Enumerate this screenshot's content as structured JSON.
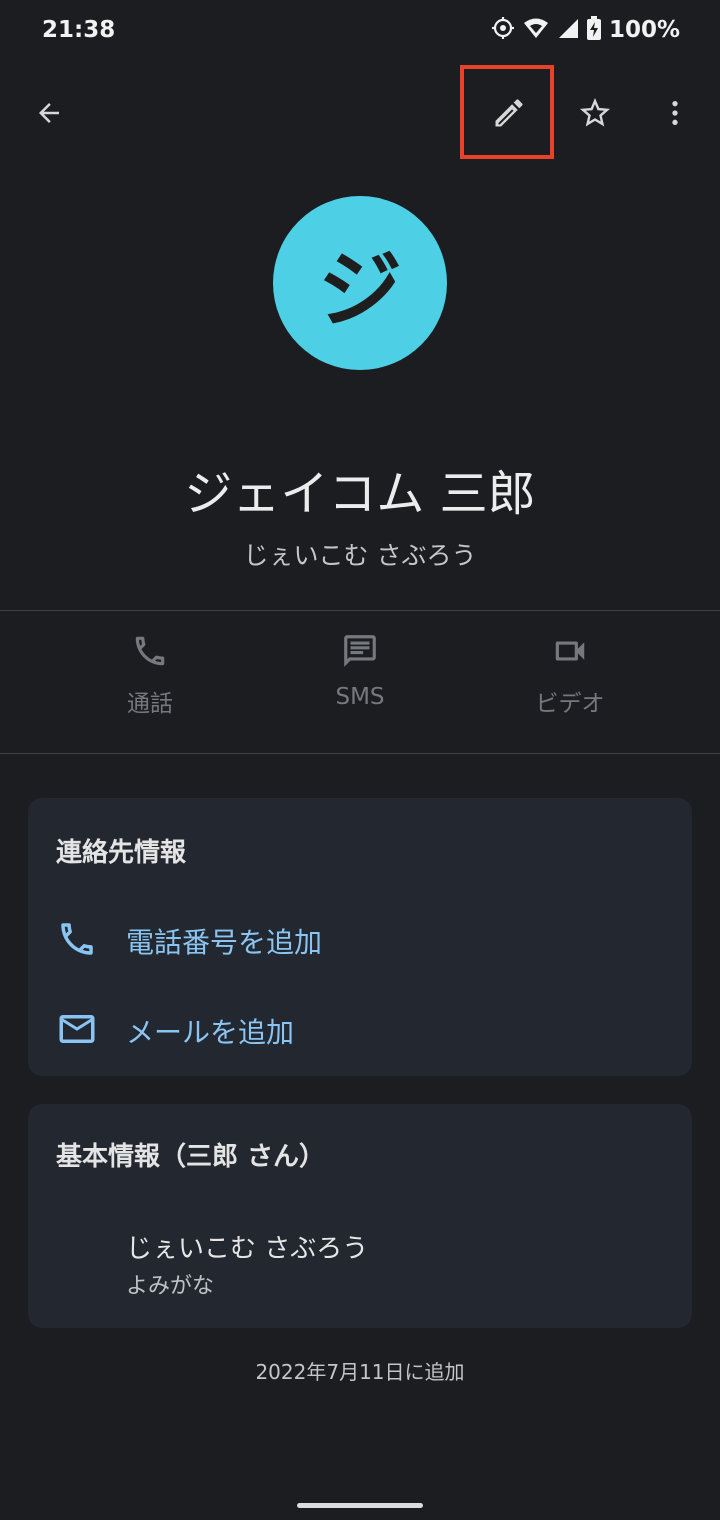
{
  "status_bar": {
    "time": "21:38",
    "battery": "100%",
    "icons": [
      "location-icon",
      "wifi-icon",
      "signal-icon",
      "battery-charging-icon"
    ]
  },
  "toolbar": {
    "back_icon": "arrow-back-icon",
    "edit_icon": "pencil-icon",
    "favorite_icon": "star-outline-icon",
    "more_icon": "more-vert-icon",
    "highlight_color": "#e8412c"
  },
  "contact": {
    "avatar_letter": "ジ",
    "avatar_color": "#4dcfe6",
    "name": "ジェイコム 三郎",
    "reading": "じぇいこむ さぶろう"
  },
  "actions": [
    {
      "label": "通話",
      "icon": "phone-icon"
    },
    {
      "label": "SMS",
      "icon": "message-icon"
    },
    {
      "label": "ビデオ",
      "icon": "video-icon"
    }
  ],
  "contact_info_card": {
    "title": "連絡先情報",
    "add_phone": "電話番号を追加",
    "add_email": "メールを追加"
  },
  "basic_info_card": {
    "title": "基本情報（三郎 さん）",
    "reading_value": "じぇいこむ さぶろう",
    "reading_label": "よみがな"
  },
  "footer": {
    "added_date": "2022年7月11日に追加"
  },
  "colors": {
    "background": "#1b1d20",
    "card": "#232830",
    "link": "#8ac4f2",
    "action_muted": "#75787d"
  }
}
